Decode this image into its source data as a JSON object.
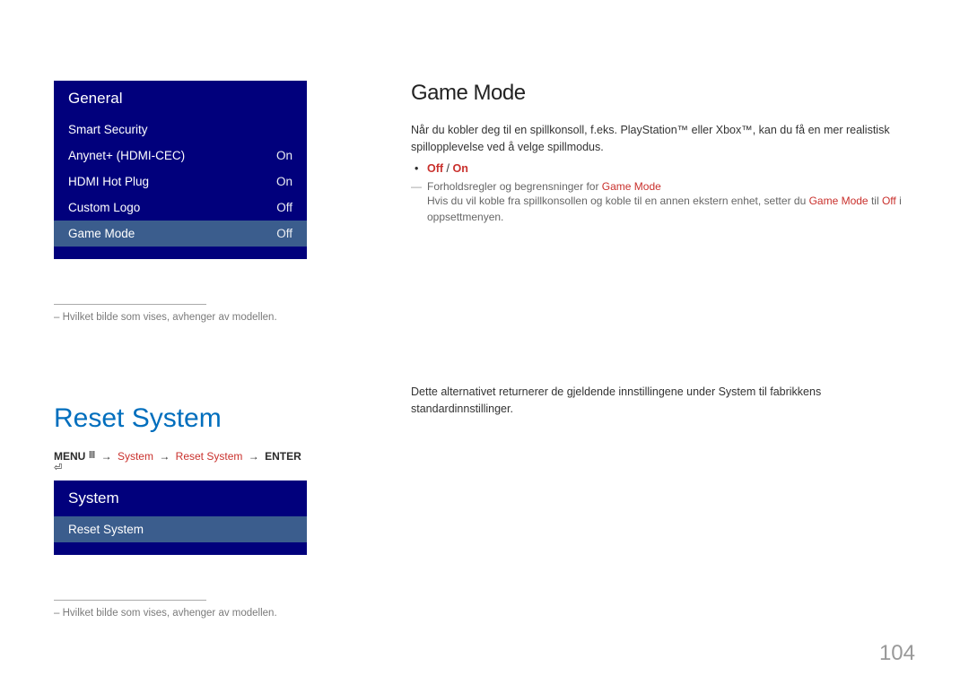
{
  "general_menu": {
    "header": "General",
    "rows": [
      {
        "label": "Smart Security",
        "value": ""
      },
      {
        "label": "Anynet+ (HDMI-CEC)",
        "value": "On"
      },
      {
        "label": "HDMI Hot Plug",
        "value": "On"
      },
      {
        "label": "Custom Logo",
        "value": "Off"
      },
      {
        "label": "Game Mode",
        "value": "Off"
      }
    ]
  },
  "caption_text": "– Hvilket bilde som vises, avhenger av modellen.",
  "reset_heading": "Reset System",
  "breadcrumb": {
    "menu": "MENU",
    "system": "System",
    "reset": "Reset System",
    "enter": "ENTER"
  },
  "system_menu": {
    "header": "System",
    "selected": "Reset System"
  },
  "game_mode": {
    "title": "Game Mode",
    "body": "Når du kobler deg til en spillkonsoll, f.eks. PlayStation™ eller Xbox™, kan du få en mer realistisk spillopplevelse ved å velge spillmodus.",
    "opt_off": "Off",
    "opt_on": "On",
    "note_title_pre": "Forholdsregler og begrensninger for ",
    "note_title_hl": "Game Mode",
    "note_body_pre": "Hvis du vil koble fra spillkonsollen og koble til en annen ekstern enhet, setter du ",
    "note_body_hl": "Game Mode",
    "note_body_mid": " til ",
    "note_body_off": "Off",
    "note_body_post": " i oppsettmenyen."
  },
  "reset_section": {
    "body": "Dette alternativet returnerer de gjeldende innstillingene under System til fabrikkens standardinnstillinger."
  },
  "page_number": "104"
}
